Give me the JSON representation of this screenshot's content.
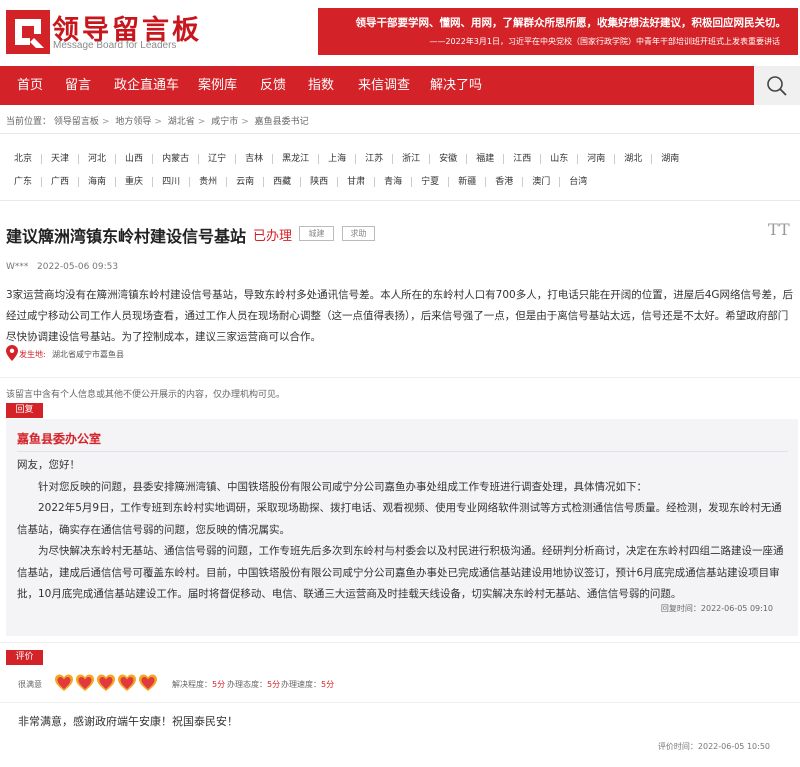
{
  "header": {
    "brand_title": "领导留言板",
    "brand_subtitle": "Message Board for Leaders",
    "banner_line1": "领导干部要学网、懂网、用网，了解群众所思所愿，收集好想法好建议，积极回应网民关切。",
    "banner_line2": "——2022年3月1日，习近平在中央党校（国家行政学院）中青年干部培训班开班式上发表重要讲话",
    "brand_color": "#d42328"
  },
  "nav": {
    "items": [
      "首页",
      "留言",
      "政企直通车",
      "案例库",
      "反馈",
      "指数",
      "来信调查",
      "解决了吗"
    ]
  },
  "breadcrumb": {
    "prefix": "当前位置：",
    "items": [
      "领导留言板",
      "地方领导",
      "湖北省",
      "咸宁市",
      "嘉鱼县委书记"
    ],
    "sep": ">"
  },
  "provinces": {
    "row1": [
      "北京",
      "天津",
      "河北",
      "山西",
      "内蒙古",
      "辽宁",
      "吉林",
      "黑龙江",
      "上海",
      "江苏",
      "浙江",
      "安徽",
      "福建",
      "江西",
      "山东",
      "河南",
      "湖北",
      "湖南"
    ],
    "row2": [
      "广东",
      "广西",
      "海南",
      "重庆",
      "四川",
      "贵州",
      "云南",
      "西藏",
      "陕西",
      "甘肃",
      "青海",
      "宁夏",
      "新疆",
      "香港",
      "澳门",
      "台湾"
    ]
  },
  "message": {
    "title": "建议簰洲湾镇东岭村建设信号基站",
    "status": "已办理",
    "tags": [
      "城建",
      "求助"
    ],
    "font_size_icon": "TT",
    "author": "W***",
    "date": "2022-05-06 09:53",
    "body": "3家运营商均没有在簰洲湾镇东岭村建设信号基站，导致东岭村多处通讯信号差。本人所在的东岭村人口有700多人，打电话只能在开阔的位置，进屋后4G网络信号差，后经过咸宁移动公司工作人员现场查看，通过工作人员在现场耐心调整（这一点值得表扬），后来信号强了一点，但是由于离信号基站太远，信号还是不太好。希望政府部门尽快协调建设信号基站。为了控制成本，建议三家运营商可以合作。",
    "location_label": "发生地:",
    "location_value": "湖北省咸宁市嘉鱼县",
    "privacy_note": "该留言中含有个人信息或其他不便公开展示的内容，仅办理机构可见。"
  },
  "reply": {
    "label": "回复",
    "from": "嘉鱼县委办公室",
    "greeting": "网友，您好！",
    "p1": "针对您反映的问题，县委安排簰洲湾镇、中国铁塔股份有限公司咸宁分公司嘉鱼办事处组成工作专班进行调查处理，具体情况如下：",
    "p2": "2022年5月9日，工作专班到东岭村实地调研，采取现场勘探、拨打电话、观看视频、使用专业网络软件测试等方式检测通信信号质量。经检测，发现东岭村无通信基站，确实存在通信信号弱的问题，您反映的情况属实。",
    "p3": "为尽快解决东岭村无基站、通信信号弱的问题，工作专班先后多次到东岭村与村委会以及村民进行积极沟通。经研判分析商讨，决定在东岭村四组二路建设一座通信基站，建成后通信信号可覆盖东岭村。目前，中国铁塔股份有限公司咸宁分公司嘉鱼办事处已完成通信基站建设用地协议签订，预计6月底完成通信基站建设项目审批，10月底完成通信基站建设工作。届时将督促移动、电信、联通三大运营商及时挂载天线设备，切实解决东岭村无基站、通信信号弱的问题。",
    "time": "回复时间：2022-06-05 09:10"
  },
  "evaluation": {
    "label": "评价",
    "satisfaction_label": "很满意",
    "hearts": 5,
    "scores": [
      {
        "name": "解决程度：",
        "value": "5分"
      },
      {
        "name": "办理态度：",
        "value": "5分"
      },
      {
        "name": "办理速度：",
        "value": "5分"
      }
    ],
    "comment": "非常满意，感谢政府端午安康！祝国泰民安！",
    "time": "评价时间：2022-06-05 10:50"
  }
}
